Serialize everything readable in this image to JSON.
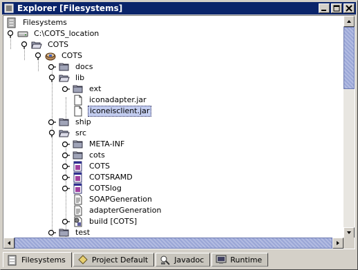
{
  "window": {
    "title": "Explorer [Filesystems]"
  },
  "title_buttons": {
    "minimize_icon": "minimize-icon",
    "maximize_icon": "maximize-icon",
    "close_icon": "close-icon"
  },
  "tree": {
    "nodes": [
      {
        "label": "Filesystems",
        "icon": "filesystems-icon"
      },
      {
        "label": "C:\\COTS_location",
        "icon": "drive-icon"
      },
      {
        "label": "COTS",
        "icon": "folder-open-icon"
      },
      {
        "label": "COTS",
        "icon": "package-icon"
      },
      {
        "label": "docs",
        "icon": "folder-icon"
      },
      {
        "label": "lib",
        "icon": "folder-open-icon"
      },
      {
        "label": "ext",
        "icon": "folder-icon"
      },
      {
        "label": "iconadapter.jar",
        "icon": "file-icon"
      },
      {
        "label": "iconeisclient.jar",
        "icon": "file-icon",
        "selected": true
      },
      {
        "label": "ship",
        "icon": "folder-icon"
      },
      {
        "label": "src",
        "icon": "folder-open-icon"
      },
      {
        "label": "META-INF",
        "icon": "folder-icon"
      },
      {
        "label": "cots",
        "icon": "folder-icon"
      },
      {
        "label": "COTS",
        "icon": "form-icon"
      },
      {
        "label": "COTSRAMD",
        "icon": "form-icon"
      },
      {
        "label": "COTSlog",
        "icon": "form-icon"
      },
      {
        "label": "SOAPGeneration",
        "icon": "document-icon"
      },
      {
        "label": "adapterGeneration",
        "icon": "document-icon"
      },
      {
        "label": "build [COTS]",
        "icon": "build-icon"
      },
      {
        "label": "test",
        "icon": "folder-icon"
      }
    ]
  },
  "tabs": [
    {
      "label": "Filesystems",
      "icon": "filesystems-icon",
      "active": true
    },
    {
      "label": "Project Default",
      "icon": "project-icon"
    },
    {
      "label": "Javadoc",
      "icon": "javadoc-icon"
    },
    {
      "label": "Runtime",
      "icon": "runtime-icon"
    }
  ]
}
